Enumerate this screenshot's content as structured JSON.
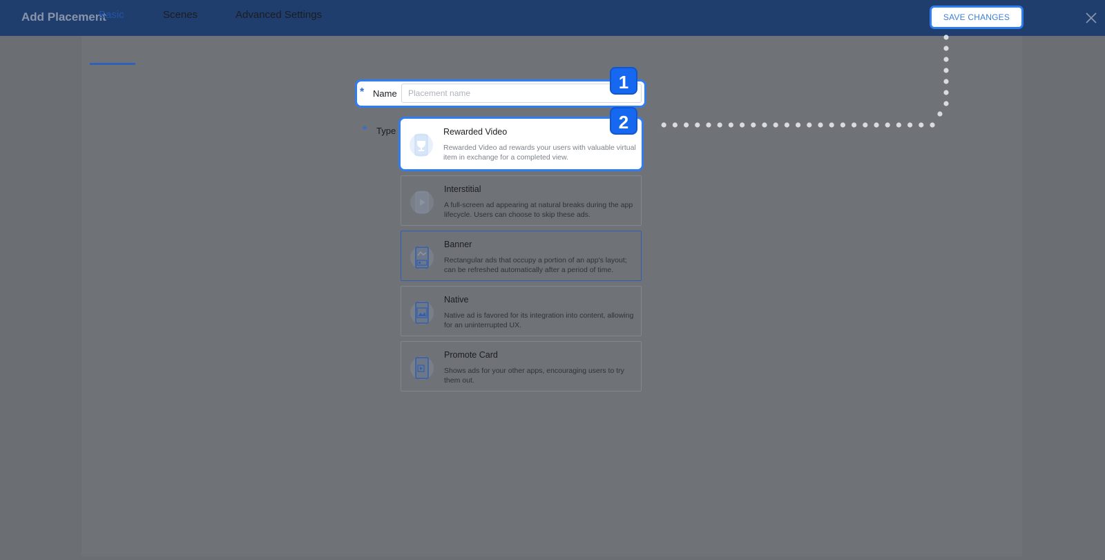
{
  "header": {
    "title": "Add Placement",
    "save_label": "SAVE CHANGES"
  },
  "tabs": [
    {
      "label": "Basic",
      "active": true
    },
    {
      "label": "Scenes",
      "active": false
    },
    {
      "label": "Advanced Settings",
      "active": false
    }
  ],
  "form": {
    "required_mark": "*",
    "name_label": "Name",
    "name_value": "",
    "name_placeholder": "Placement name",
    "type_label": "Type"
  },
  "badges": [
    "1",
    "2"
  ],
  "types": [
    {
      "title": "Rewarded Video",
      "desc": "Rewarded Video ad rewards your users with valuable virtual item in exchange for a completed view.",
      "icon": "trophy-icon"
    },
    {
      "title": "Interstitial",
      "desc": "A full-screen ad appearing at natural breaks during the app lifecycle. Users can choose to skip these ads.",
      "icon": "play-icon"
    },
    {
      "title": "Banner",
      "desc": "Rectangular ads that occupy a portion of an app's layout; can be refreshed automatically after a period of time.",
      "icon": "banner-icon"
    },
    {
      "title": "Native",
      "desc": "Native ad is favored for its integration into content, allowing for an uninterrupted UX.",
      "icon": "image-icon"
    },
    {
      "title": "Promote Card",
      "desc": "Shows ads for your other apps, encouraging users to try them out.",
      "icon": "promote-card-icon"
    }
  ],
  "colors": {
    "header": "#1f3e6d",
    "accent": "#2f7df2",
    "badge": "#1668f0"
  }
}
